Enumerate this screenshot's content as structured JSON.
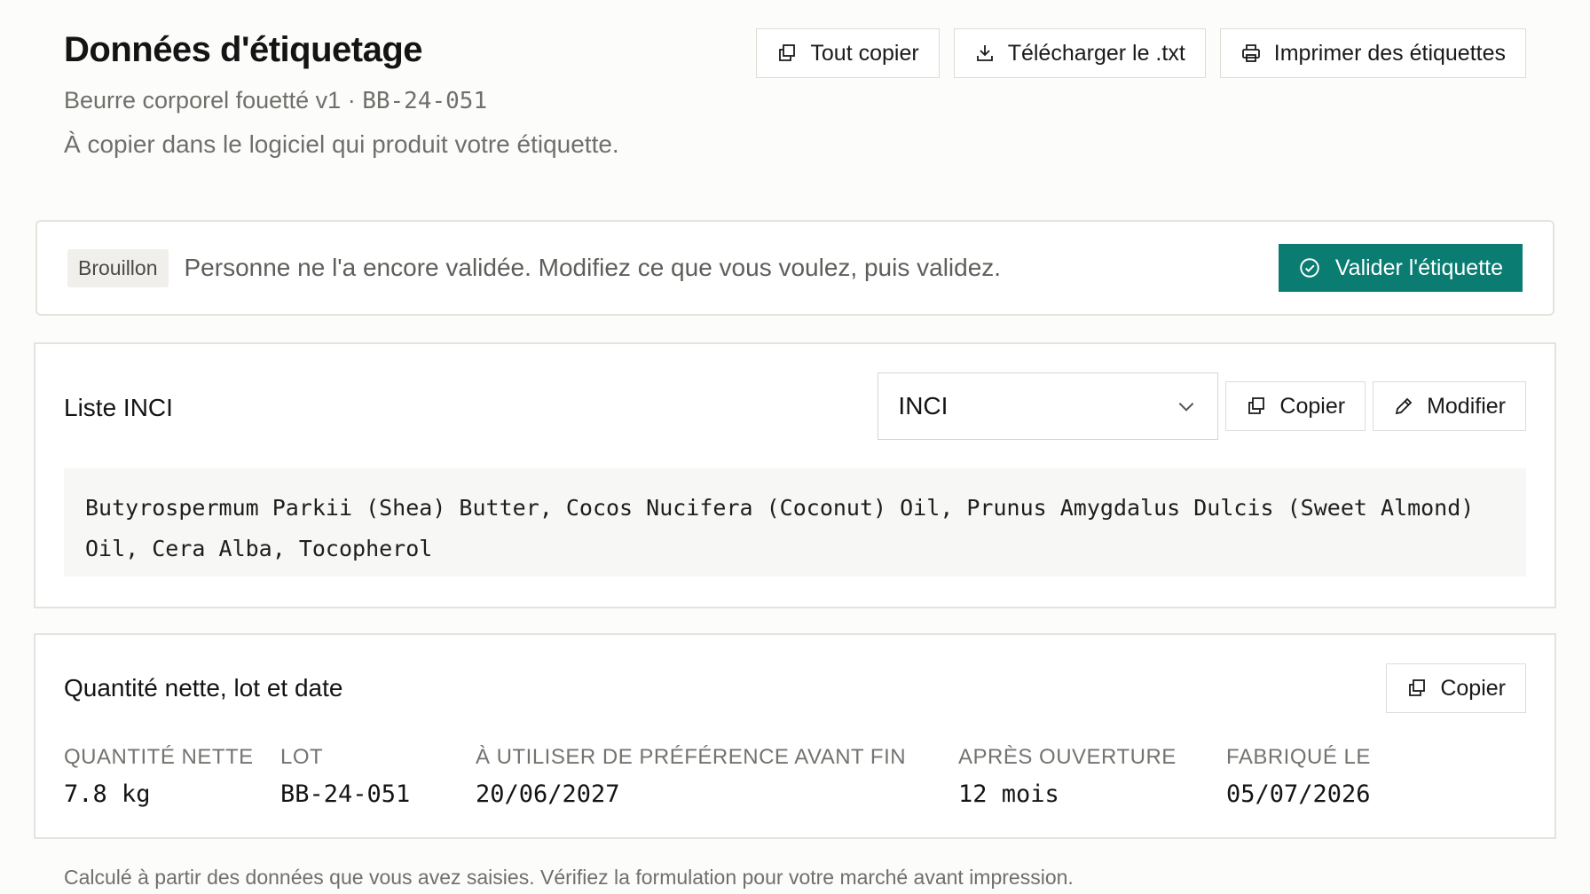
{
  "header": {
    "title": "Données d'étiquetage",
    "product_name": "Beurre corporel fouetté v1",
    "separator": "·",
    "batch_code": "BB-24-051",
    "description": "À copier dans le logiciel qui produit votre étiquette."
  },
  "toolbar": {
    "copy_all_label": "Tout copier",
    "download_label": "Télécharger le .txt",
    "print_label": "Imprimer des étiquettes"
  },
  "status_banner": {
    "badge": "Brouillon",
    "message": "Personne ne l'a encore validée. Modifiez ce que vous voulez, puis validez.",
    "validate_label": "Valider l'étiquette",
    "accent_color": "#0a7c72"
  },
  "inci_card": {
    "title": "Liste INCI",
    "format_select_value": "INCI",
    "copy_label": "Copier",
    "edit_label": "Modifier",
    "ingredients_text": "Butyrospermum Parkii (Shea) Butter, Cocos Nucifera (Coconut) Oil, Prunus Amygdalus Dulcis (Sweet Almond) Oil, Cera Alba, Tocopherol"
  },
  "quantity_card": {
    "title": "Quantité nette, lot et date",
    "copy_label": "Copier",
    "fields": [
      {
        "label": "QUANTITÉ NETTE",
        "value": "7.8 kg"
      },
      {
        "label": "LOT",
        "value": "BB-24-051"
      },
      {
        "label": "À UTILISER DE PRÉFÉRENCE AVANT FIN",
        "value": "20/06/2027"
      },
      {
        "label": "APRÈS OUVERTURE",
        "value": "12 mois"
      },
      {
        "label": "FABRIQUÉ LE",
        "value": "05/07/2026"
      }
    ]
  },
  "footnote": "Calculé à partir des données que vous avez saisies. Vérifiez la formulation pour votre marché avant impression."
}
